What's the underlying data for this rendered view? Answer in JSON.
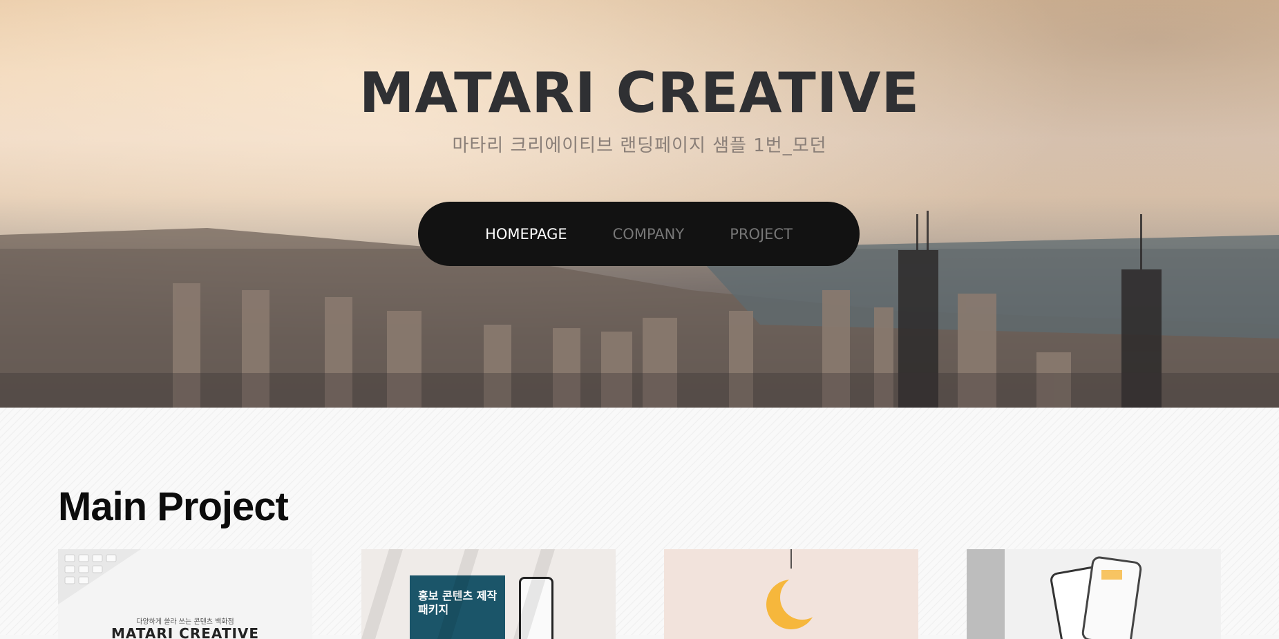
{
  "hero": {
    "title": "MATARI CREATIVE",
    "subtitle": "마타리 크리에이티브 랜딩페이지 샘플 1번_모던"
  },
  "nav": {
    "items": [
      {
        "label": "HOMEPAGE",
        "active": true
      },
      {
        "label": "COMPANY",
        "active": false
      },
      {
        "label": "PROJECT",
        "active": false
      }
    ]
  },
  "main": {
    "section_title": "Main Project",
    "cards": [
      {
        "caption": "다양하게 쓸라 쓰는 콘텐츠 백화점",
        "brand": "MATARI CREATIVE"
      },
      {
        "book_title": "홍보 콘텐츠 제작 패키지"
      },
      {},
      {}
    ]
  },
  "colors": {
    "nav_bg": "#121212",
    "nav_active": "#ffffff",
    "nav_inactive": "#777777",
    "title": "#2f3033"
  }
}
